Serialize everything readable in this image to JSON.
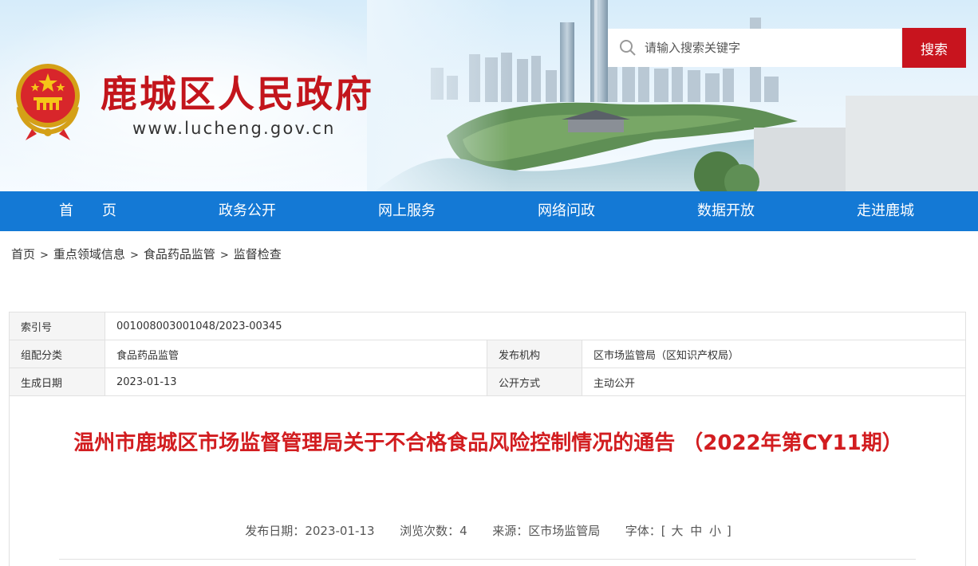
{
  "header": {
    "site_title": "鹿城区人民政府",
    "site_url": "www.lucheng.gov.cn",
    "search": {
      "placeholder": "请输入搜索关键字",
      "button_label": "搜索"
    },
    "colors": {
      "brand_red": "#c8141e",
      "nav_blue": "#1479d5"
    },
    "emblem_icon": "national-emblem-icon"
  },
  "nav": {
    "items": [
      {
        "label": "首　　页"
      },
      {
        "label": "政务公开"
      },
      {
        "label": "网上服务"
      },
      {
        "label": "网络问政"
      },
      {
        "label": "数据开放"
      },
      {
        "label": "走进鹿城"
      }
    ]
  },
  "breadcrumb": {
    "items": [
      "首页",
      "重点领域信息",
      "食品药品监管",
      "监督检查"
    ],
    "separator": ">"
  },
  "meta": {
    "index_label": "索引号",
    "index_value": "001008003001048/2023-00345",
    "category_label": "组配分类",
    "category_value": "食品药品监管",
    "publisher_label": "发布机构",
    "publisher_value": "区市场监管局（区知识产权局）",
    "date_label": "生成日期",
    "date_value": "2023-01-13",
    "disclosure_label": "公开方式",
    "disclosure_value": "主动公开"
  },
  "article": {
    "title": "温州市鹿城区市场监督管理局关于不合格食品风险控制情况的通告 （2022年第CY11期）",
    "publish_date_label": "发布日期：",
    "publish_date": "2023-01-13",
    "views_label": "浏览次数：",
    "views": "4",
    "source_label": "来源：",
    "source": "区市场监管局",
    "font_label": "字体：",
    "font_open": "[",
    "font_large": "大",
    "font_medium": "中",
    "font_small": "小",
    "font_close": "]"
  }
}
